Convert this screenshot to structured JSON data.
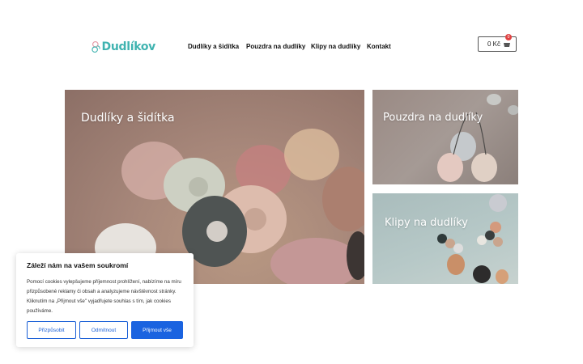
{
  "header": {
    "logo_text": "Dudlíkov",
    "nav": [
      {
        "label": "Dudlíky a šidítka"
      },
      {
        "label": "Pouzdra na dudlíky"
      },
      {
        "label": "Klipy na dudlíky"
      },
      {
        "label": "Kontakt"
      }
    ],
    "cart": {
      "total": "0 Kč",
      "count": "0"
    }
  },
  "tiles": [
    {
      "title": "Dudlíky a šidítka"
    },
    {
      "title": "Pouzdra na dudlíky"
    },
    {
      "title": "Klipy na dudlíky"
    }
  ],
  "cookie": {
    "title": "Záleží nám na vašem soukromí",
    "text": "Pomocí cookies vylepšujeme příjemnost prohlížení, nabízíme na míru přizpůsobené reklamy či obsah a analyzujeme návštěvnost stránky. Kliknutím na „Přijmout vše\" vyjadřujete souhlas s tím, jak cookies používáme.",
    "buttons": {
      "customize": "Přizpůsobit",
      "reject": "Odmítnout",
      "accept": "Přijmout vše"
    }
  },
  "colors": {
    "brand": "#3fb3b0",
    "accent": "#1a63e0",
    "badge": "#e04343"
  }
}
